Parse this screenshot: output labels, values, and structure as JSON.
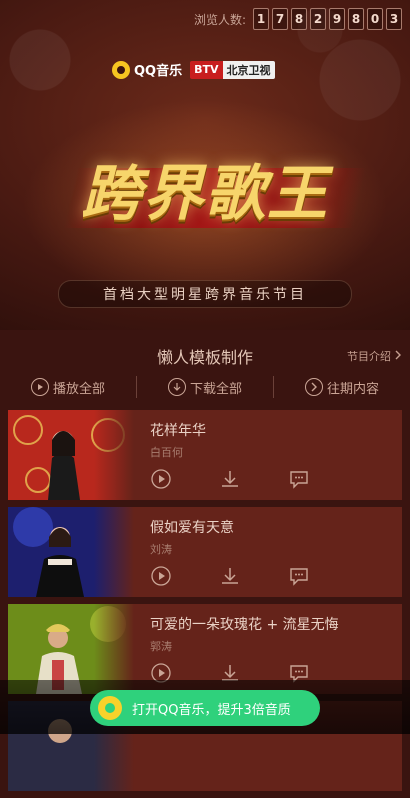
{
  "header": {
    "visit_label": "浏览人数:",
    "visit_digits": [
      "1",
      "7",
      "8",
      "2",
      "9",
      "8",
      "0",
      "3"
    ]
  },
  "logos": {
    "qq_text": "QQ音乐",
    "btv_left": "BTV",
    "btv_right": "北京卫视"
  },
  "hero": {
    "title": "跨界歌王",
    "subtitle": "首档大型明星跨界音乐节目"
  },
  "section": {
    "title": "懒人模板制作",
    "intro_link": "节目介绍"
  },
  "actions": [
    {
      "label": "播放全部",
      "icon": "play-circle-icon"
    },
    {
      "label": "下载全部",
      "icon": "download-circle-icon"
    },
    {
      "label": "往期内容",
      "icon": "chevron-right-circle-icon"
    }
  ],
  "songs": [
    {
      "title": "花样年华",
      "singer": "白百何"
    },
    {
      "title": "假如爱有天意",
      "singer": "刘涛"
    },
    {
      "title": "可爱的一朵玫瑰花 + 流星无悔",
      "singer": "郭涛"
    }
  ],
  "banner": {
    "button_text": "打开QQ音乐，提升3倍音质"
  },
  "colors": {
    "background": "#3a1410",
    "card": "#65231a",
    "accent_green": "#2fd17c",
    "qq_yellow": "#f6c521"
  }
}
